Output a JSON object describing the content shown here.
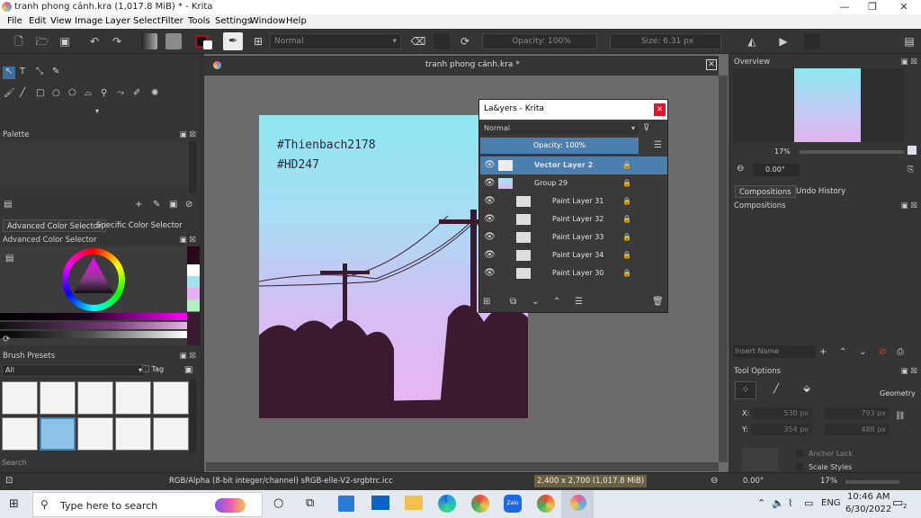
{
  "window": {
    "title": "tranh phong cảnh.kra (1,017.8 MiB)  * - Krita",
    "controls": [
      "minimize-icon",
      "maximize-icon",
      "close-icon"
    ]
  },
  "menubar": {
    "items": [
      "File",
      "Edit",
      "View",
      "Image",
      "Layer",
      "Select",
      "Filter",
      "Tools",
      "Settings",
      "Window",
      "Help"
    ]
  },
  "toolbar": {
    "blend_mode": "Normal",
    "opacity": "Opacity: 100%",
    "size": "Size: 6.31 px"
  },
  "canvas": {
    "tab_title": "tranh phong cảnh.kra *",
    "text_line1": "#Thienbach2178",
    "text_line2": "#HD247"
  },
  "left": {
    "palette_title": "Palette",
    "color_tabs": [
      "Advanced Color Selector",
      "Specific Color Selector"
    ],
    "color_selector_title": "Advanced Color Selector",
    "brush_presets_title": "Brush Presets",
    "brush_filter": "All",
    "brush_tag": "Tag",
    "search_placeholder": "Search"
  },
  "layers": {
    "title": "La&yers - Krita",
    "blend_mode": "Normal",
    "opacity": "Opacity:  100%",
    "items": [
      {
        "name": "Vector Layer 2",
        "selected": true
      },
      {
        "name": "Group 29",
        "selected": false
      },
      {
        "name": "Paint Layer 31",
        "selected": false
      },
      {
        "name": "Paint Layer 32",
        "selected": false
      },
      {
        "name": "Paint Layer 33",
        "selected": false
      },
      {
        "name": "Paint Layer 34",
        "selected": false
      },
      {
        "name": "Paint Layer 30",
        "selected": false
      }
    ]
  },
  "right": {
    "overview_title": "Overview",
    "zoom": "17%",
    "rotation": "0.00°",
    "tabs": [
      "Compositions",
      "Undo History"
    ],
    "compositions_title": "Compositions",
    "insert_name_placeholder": "Insert Name",
    "tool_options_title": "Tool Options",
    "geometry_label": "Geometry",
    "x_label": "X:",
    "y_label": "Y:",
    "x_value": "530 px",
    "y_value": "354 px",
    "w_value": "793 px",
    "h_value": "488 px",
    "anchor_lock": "Anchor Lock",
    "scale_styles": "Scale Styles"
  },
  "status": {
    "color_profile": "RGB/Alpha (8-bit integer/channel)  sRGB-elle-V2-srgbtrc.icc",
    "dimensions": "2,400 x 2,700 (1,017.8 MiB)",
    "rotation": "0.00°",
    "zoom": "17%"
  },
  "taskbar": {
    "search_placeholder": "Type here to search",
    "language": "ENG",
    "time": "10:46 AM",
    "date": "6/30/2022",
    "notification_count": "2"
  },
  "colors": {
    "accent": "#3d6f9e",
    "layer_selected": "#4d7fae",
    "canvas_sky_top": "#8fe8f2",
    "canvas_sky_bottom": "#e3b4f2",
    "silhouette": "#3a1a2e"
  }
}
